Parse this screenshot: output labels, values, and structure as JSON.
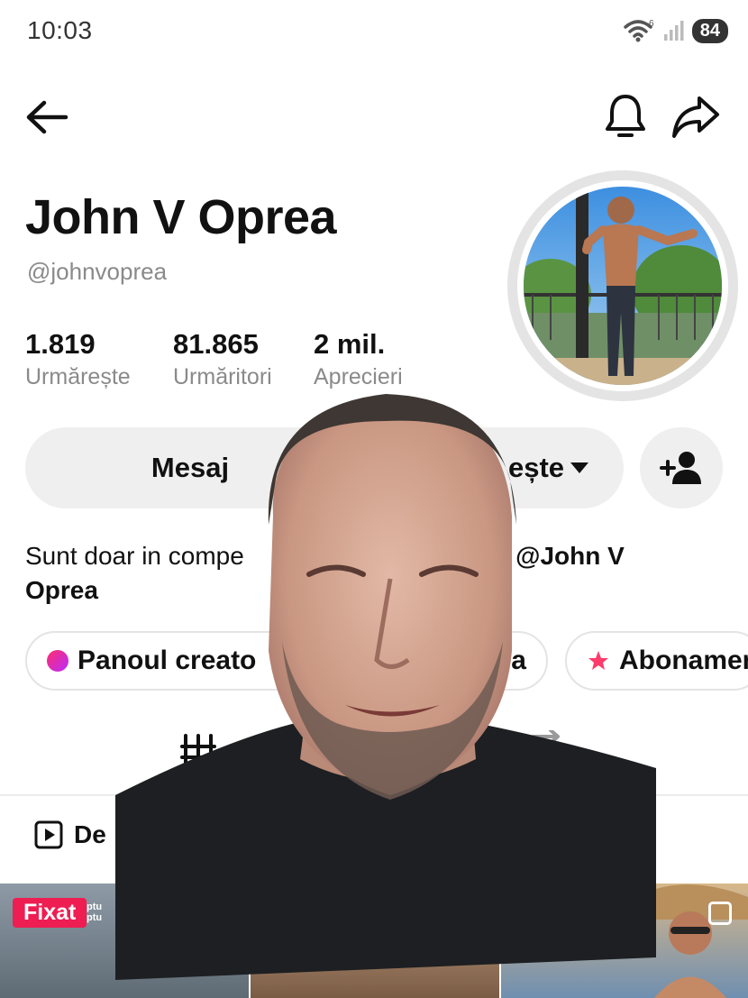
{
  "status_bar": {
    "time": "10:03",
    "network_badge": "6",
    "battery": "84"
  },
  "header": {
    "back_icon": "arrow-left-icon",
    "bell_icon": "bell-icon",
    "share_icon": "share-arrow-icon"
  },
  "profile": {
    "display_name": "John V Oprea",
    "handle": "@johnvoprea",
    "stats": [
      {
        "value": "1.819",
        "label": "Urmărește"
      },
      {
        "value": "81.865",
        "label": "Urmăritori"
      },
      {
        "value": "2 mil.",
        "label": "Aprecieri"
      }
    ]
  },
  "actions": {
    "message": "Mesaj",
    "follow": "ește",
    "add_friend_icon": "add-user-icon"
  },
  "bio": {
    "text": "Sunt doar in compe",
    "text_end": "a ",
    "mention": "@John V",
    "line2": "Oprea"
  },
  "chips": [
    {
      "label": "Panoul creato",
      "icon": "creator-dot-icon"
    },
    {
      "label": "ea",
      "icon": "none"
    },
    {
      "label": "Abonamen",
      "icon": "star-icon"
    }
  ],
  "tabs": {
    "grid_icon": "grid-icon",
    "repost_icon": "repost-icon",
    "subtab_label": "De"
  },
  "grid": {
    "pinned_label": "Fixat",
    "tile_caption": [
      "ptu",
      "ptu"
    ]
  },
  "colors": {
    "accent": "#ee1d52",
    "secondary_text": "#8a8a8a",
    "button_bg": "#efefef"
  }
}
